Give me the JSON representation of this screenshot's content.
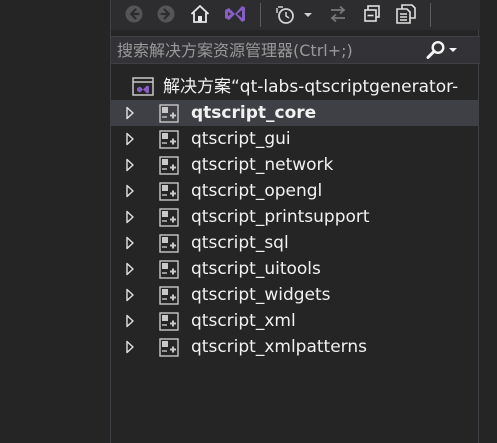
{
  "search": {
    "placeholder": "搜索解决方案资源管理器(Ctrl+;)"
  },
  "solution": {
    "label": "解决方案“qt-labs-qtscriptgenerator-"
  },
  "projects": [
    {
      "label": "qtscript_core",
      "selected": true
    },
    {
      "label": "qtscript_gui"
    },
    {
      "label": "qtscript_network"
    },
    {
      "label": "qtscript_opengl"
    },
    {
      "label": "qtscript_printsupport"
    },
    {
      "label": "qtscript_sql"
    },
    {
      "label": "qtscript_uitools"
    },
    {
      "label": "qtscript_widgets"
    },
    {
      "label": "qtscript_xml"
    },
    {
      "label": "qtscript_xmlpatterns"
    }
  ],
  "icons": {
    "back": "back-icon",
    "forward": "forward-icon",
    "home": "home-icon",
    "vs_switch_views": "visual-studio-icon",
    "pending_changes": "history-clock-icon",
    "sync": "sync-icon",
    "collapse_all": "collapse-all-icon",
    "show_all_files": "show-all-files-icon",
    "search": "search-icon",
    "dropdown": "chevron-down-icon",
    "project": "project-icon",
    "expander": "expander-arrow-icon"
  },
  "colors": {
    "background": "#252526",
    "toolbar": "#2d2d30",
    "search_box": "#333337",
    "selected_row": "#3f3f46",
    "text": "#f1f1f1",
    "placeholder": "#999999",
    "vs_purple": "#865fc5"
  }
}
